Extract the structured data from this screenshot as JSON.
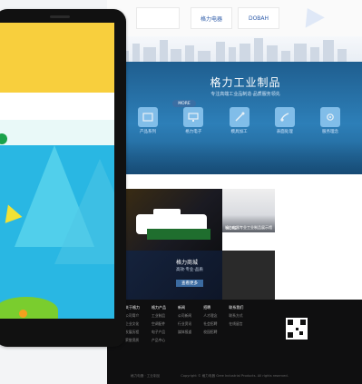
{
  "tablet": {
    "screen": "yellow-white-blue-landing"
  },
  "website": {
    "top_logos": [
      {
        "label": ""
      },
      {
        "label": "格力电器"
      },
      {
        "label": "DOBAH"
      }
    ],
    "banner": {
      "title": "格力工业制品",
      "subtitle": "专注高端工业品制造·品质服务领先",
      "pill": "MORE"
    },
    "icons": [
      {
        "label": "产品系列"
      },
      {
        "label": "格力电子"
      },
      {
        "label": "模具加工"
      },
      {
        "label": "表面处理"
      },
      {
        "label": "服务理念"
      }
    ],
    "content": {
      "card_title": "格力商城",
      "card_subtitle": "高效·专业·品质",
      "card_button": "查看更多",
      "caption": "格力电器专业工业制品展示馆",
      "more": "MORE"
    },
    "footer": {
      "columns": [
        {
          "heading": "关于格力",
          "links": [
            "公司简介",
            "企业文化",
            "发展历程",
            "荣誉资质"
          ]
        },
        {
          "heading": "格力产品",
          "links": [
            "工业制品",
            "空调配件",
            "电子产品",
            "产品中心"
          ]
        },
        {
          "heading": "新闻",
          "links": [
            "公司新闻",
            "行业资讯",
            "媒体报道"
          ]
        },
        {
          "heading": "招聘",
          "links": [
            "人才理念",
            "社会招聘",
            "校园招聘"
          ]
        },
        {
          "heading": "联系我们",
          "links": [
            "联系方式",
            "在线留言"
          ]
        }
      ],
      "copyright": "Copyright © 格力电器 Gree Industrial Products. All rights reserved.",
      "left_text": "格力电器 · 工业制品"
    }
  },
  "colors": {
    "banner": "#2d7fb8",
    "tablet_screen": "#29b7e3",
    "tablet_yellow": "#f8cf3d",
    "footer": "#0f0f10"
  }
}
